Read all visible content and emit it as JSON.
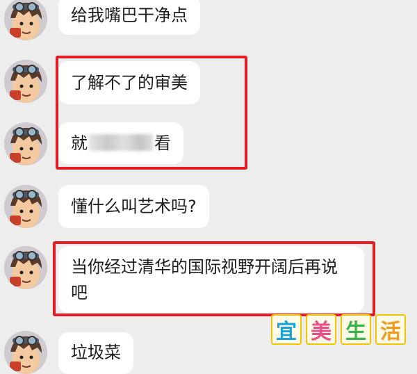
{
  "messages": [
    {
      "text": "给我嘴巴干净点"
    },
    {
      "text": "了解不了的审美"
    },
    {
      "text_before": "就",
      "text_after": "看"
    },
    {
      "text": "懂什么叫艺术吗?"
    },
    {
      "text": "当你经过清华的国际视野开阔后再说吧"
    },
    {
      "text": "垃圾菜"
    }
  ],
  "watermark": {
    "chars": [
      "宜",
      "美",
      "生",
      "活"
    ]
  },
  "colors": {
    "highlight": "#e31b23",
    "bubble": "#ffffff",
    "background": "#ededed",
    "watermark_text": "#1aa3d8",
    "watermark_border": "#f3c400"
  },
  "icons": {
    "avatar": "cartoon-boy-with-goggles-avatar"
  }
}
